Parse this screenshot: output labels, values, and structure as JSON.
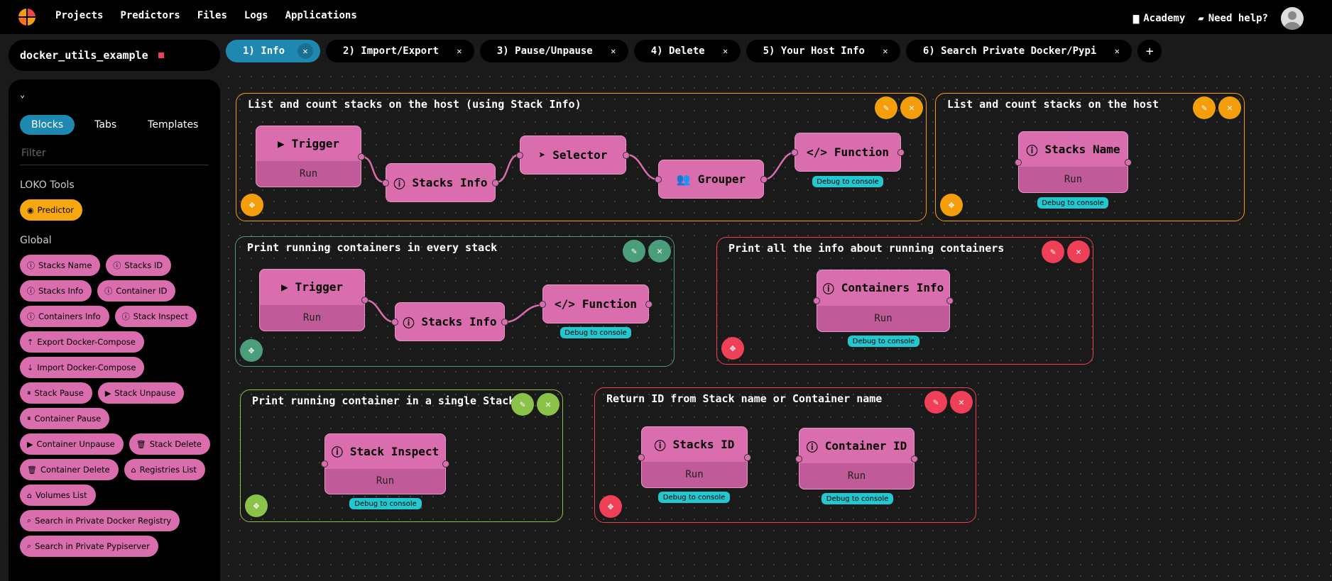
{
  "nav": {
    "items": [
      "Projects",
      "Predictors",
      "Files",
      "Logs",
      "Applications"
    ],
    "academy": "Academy",
    "help": "Need help?"
  },
  "project": {
    "name": "docker_utils_example"
  },
  "tabs": [
    {
      "label": "1) Info"
    },
    {
      "label": "2) Import/Export"
    },
    {
      "label": "3) Pause/Unpause"
    },
    {
      "label": "4) Delete"
    },
    {
      "label": "5) Your Host Info"
    },
    {
      "label": "6) Search Private Docker/Pypi"
    }
  ],
  "sidebar": {
    "tabs": [
      "Blocks",
      "Tabs",
      "Templates"
    ],
    "filter_placeholder": "Filter",
    "section1": "LOKO Tools",
    "predictor": "Predictor",
    "section2": "Global",
    "blocks": [
      "Stacks Name",
      "Stacks ID",
      "Stacks Info",
      "Container ID",
      "Containers Info",
      "Stack Inspect",
      "Export Docker-Compose",
      "Import Docker-Compose",
      "Stack Pause",
      "Stack Unpause",
      "Container Pause",
      "Container Unpause",
      "Stack Delete",
      "Container Delete",
      "Registries List",
      "Volumes List",
      "Search in Private Docker Registry",
      "Search in Private Pypiserver"
    ]
  },
  "groups": [
    {
      "title": "List and count stacks on the host (using Stack Info)"
    },
    {
      "title": "List and count stacks on the host"
    },
    {
      "title": "Print running containers in every stack"
    },
    {
      "title": "Print all the info about running containers"
    },
    {
      "title": "Print running container in a single Stack"
    },
    {
      "title": "Return ID from Stack name or Container name"
    }
  ],
  "nodes": {
    "trigger": "Trigger",
    "run": "Run",
    "stacks_info": "Stacks Info",
    "selector": "Selector",
    "grouper": "Grouper",
    "function": "Function",
    "stacks_name": "Stacks Name",
    "containers_info": "Containers Info",
    "stack_inspect": "Stack Inspect",
    "stacks_id": "Stacks ID",
    "container_id": "Container ID",
    "debug": "Debug to console"
  }
}
